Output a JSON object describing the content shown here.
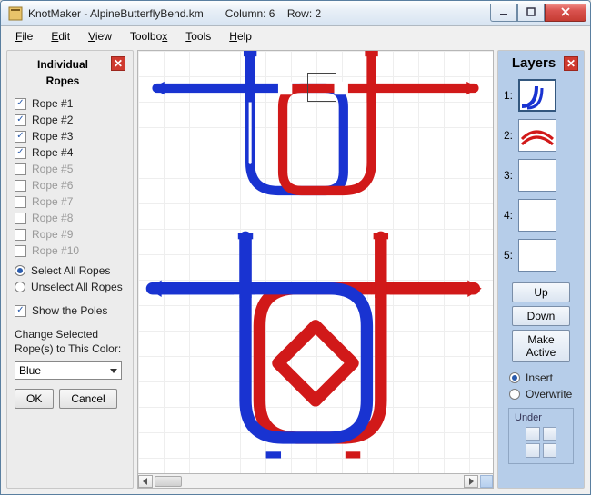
{
  "title": "KnotMaker - AlpineButterflyBend.km",
  "status": {
    "column_label": "Column:",
    "column_value": "6",
    "row_label": "Row:",
    "row_value": "2"
  },
  "menu": [
    "File",
    "Edit",
    "View",
    "Toolbox",
    "Tools",
    "Help"
  ],
  "left": {
    "title_line1": "Individual",
    "title_line2": "Ropes",
    "ropes": [
      {
        "label": "Rope #1",
        "checked": true
      },
      {
        "label": "Rope #2",
        "checked": true
      },
      {
        "label": "Rope #3",
        "checked": true
      },
      {
        "label": "Rope #4",
        "checked": true
      },
      {
        "label": "Rope #5",
        "checked": false
      },
      {
        "label": "Rope #6",
        "checked": false
      },
      {
        "label": "Rope #7",
        "checked": false
      },
      {
        "label": "Rope #8",
        "checked": false
      },
      {
        "label": "Rope #9",
        "checked": false
      },
      {
        "label": "Rope #10",
        "checked": false
      }
    ],
    "select_all": "Select All Ropes",
    "unselect_all": "Unselect All Ropes",
    "select_mode": "select",
    "show_poles": "Show the Poles",
    "show_poles_checked": true,
    "color_label_line1": "Change Selected",
    "color_label_line2": "Rope(s) to This Color:",
    "color_value": "Blue",
    "ok": "OK",
    "cancel": "Cancel"
  },
  "right": {
    "title": "Layers",
    "layers": [
      "1:",
      "2:",
      "3:",
      "4:",
      "5:"
    ],
    "selected_layer": 0,
    "up": "Up",
    "down": "Down",
    "make_active": "Make\nActive",
    "insert": "Insert",
    "overwrite": "Overwrite",
    "insert_mode": "insert",
    "under": "Under"
  },
  "colors": {
    "blue": "#1933d1",
    "red": "#d11919"
  }
}
